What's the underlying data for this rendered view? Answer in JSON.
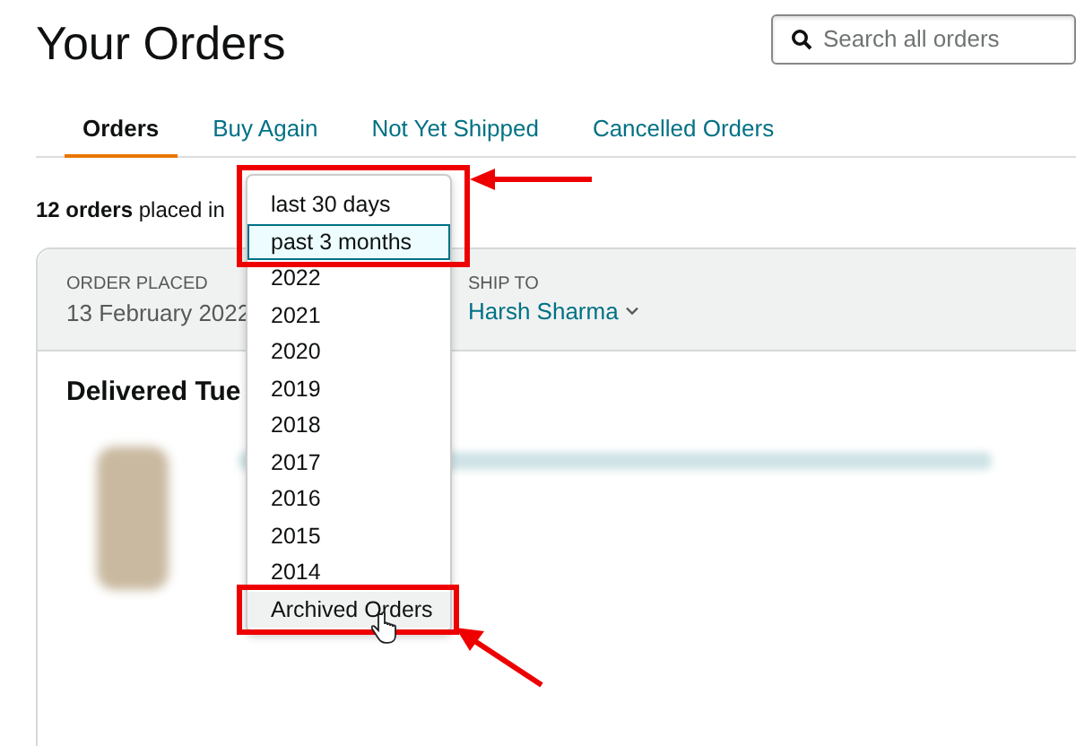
{
  "title": "Your Orders",
  "search": {
    "placeholder": "Search all orders"
  },
  "tabs": [
    {
      "label": "Orders",
      "selected": true
    },
    {
      "label": "Buy Again",
      "selected": false
    },
    {
      "label": "Not Yet Shipped",
      "selected": false
    },
    {
      "label": "Cancelled Orders",
      "selected": false
    }
  ],
  "summary": "**12 orders** placed in",
  "period_dropdown": {
    "options": [
      {
        "label": "last 30 days",
        "selected": false,
        "hovered": false
      },
      {
        "label": "past 3 months",
        "selected": true,
        "hovered": false
      },
      {
        "label": "2022",
        "selected": false,
        "hovered": false
      },
      {
        "label": "2021",
        "selected": false,
        "hovered": false
      },
      {
        "label": "2020",
        "selected": false,
        "hovered": false
      },
      {
        "label": "2019",
        "selected": false,
        "hovered": false
      },
      {
        "label": "2018",
        "selected": false,
        "hovered": false
      },
      {
        "label": "2017",
        "selected": false,
        "hovered": false
      },
      {
        "label": "2016",
        "selected": false,
        "hovered": false
      },
      {
        "label": "2015",
        "selected": false,
        "hovered": false
      },
      {
        "label": "2014",
        "selected": false,
        "hovered": false
      },
      {
        "label": "Archived Orders",
        "selected": false,
        "hovered": true
      }
    ]
  },
  "order": {
    "order_placed_label": "ORDER PLACED",
    "order_placed": "13 February 2022",
    "ship_to_label": "SHIP TO",
    "ship_to": "Harsh Sharma",
    "status": "Delivered Tue"
  }
}
